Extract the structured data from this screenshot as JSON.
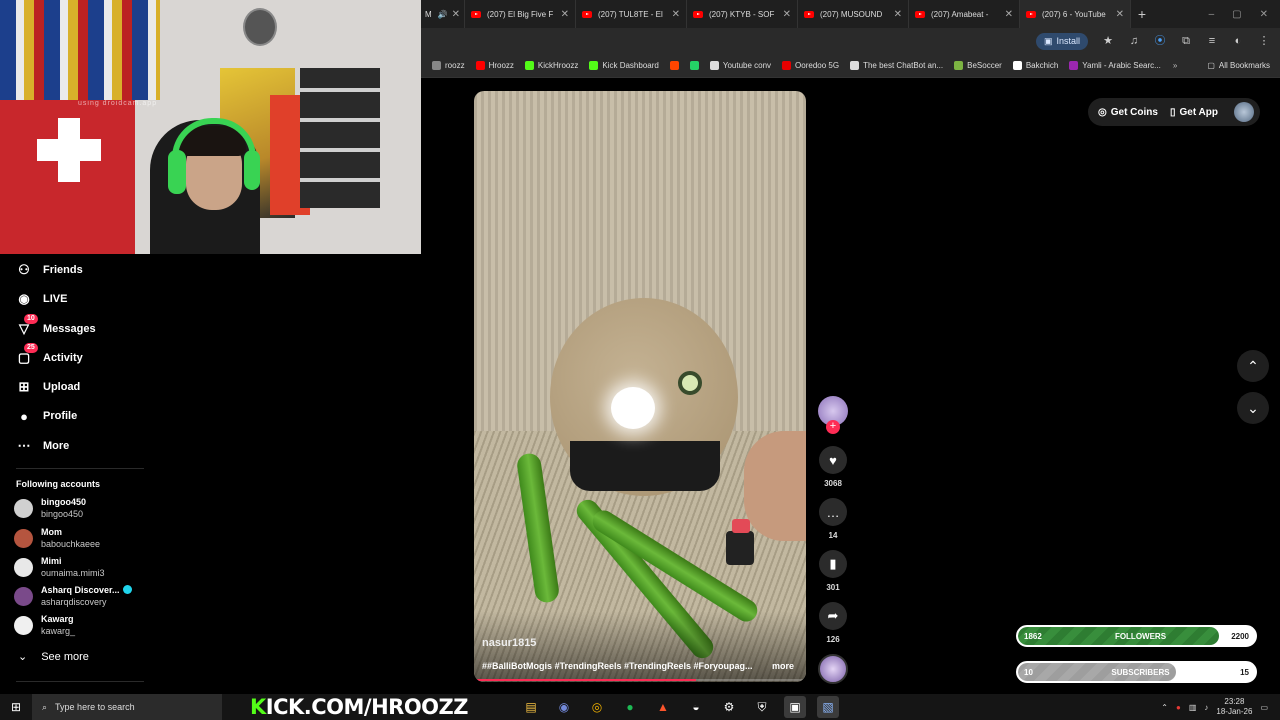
{
  "browser": {
    "tabs": [
      {
        "label": "M"
      },
      {
        "label": "(207) El Big Five F"
      },
      {
        "label": "(207) TUL8TE - El"
      },
      {
        "label": "(207) KTYB - SOF"
      },
      {
        "label": "(207) MUSOUND"
      },
      {
        "label": "(207) Amabeat -"
      },
      {
        "label": "(207) 6 - YouTube"
      }
    ],
    "install_label": "Install",
    "bookmarks": [
      {
        "label": "roozz",
        "color": "#888888"
      },
      {
        "label": "Hroozz",
        "color": "#ff0000"
      },
      {
        "label": "KickHroozz",
        "color": "#53fc18"
      },
      {
        "label": "Kick Dashboard",
        "color": "#53fc18"
      },
      {
        "label": "",
        "color": "#ff4500"
      },
      {
        "label": "",
        "color": "#25d366"
      },
      {
        "label": "Youtube conv",
        "color": "#dddddd"
      },
      {
        "label": "Ooredoo 5G",
        "color": "#e60000"
      },
      {
        "label": "The best ChatBot an...",
        "color": "#dddddd"
      },
      {
        "label": "BeSoccer",
        "color": "#7cb342"
      },
      {
        "label": "Bakchich",
        "color": "#ffffff"
      },
      {
        "label": "Yamli - Arabic Searc...",
        "color": "#9c27b0"
      }
    ],
    "all_bookmarks": "All Bookmarks"
  },
  "webcam": {
    "watermark": "using droidcam.app"
  },
  "sidebar": {
    "items": [
      {
        "label": "Friends",
        "icon": "friends-icon",
        "glyph": "⚇"
      },
      {
        "label": "LIVE",
        "icon": "live-icon",
        "glyph": "◉"
      },
      {
        "label": "Messages",
        "icon": "messages-icon",
        "glyph": "▽",
        "badge": "10"
      },
      {
        "label": "Activity",
        "icon": "activity-icon",
        "glyph": "▢",
        "badge": "25"
      },
      {
        "label": "Upload",
        "icon": "upload-icon",
        "glyph": "⊞"
      },
      {
        "label": "Profile",
        "icon": "profile-icon",
        "glyph": "●"
      },
      {
        "label": "More",
        "icon": "more-icon",
        "glyph": "⋯"
      }
    ],
    "following_title": "Following accounts",
    "accounts": [
      {
        "name": "bingoo450",
        "handle": "bingoo450",
        "color": "#d0d0d0",
        "verified": false
      },
      {
        "name": "Mom",
        "handle": "babouchkaeee",
        "color": "#b5553f",
        "verified": false
      },
      {
        "name": "Mimi",
        "handle": "oumaima.mimi3",
        "color": "#e8e8e8",
        "verified": false
      },
      {
        "name": "Asharq Discover...",
        "handle": "asharqdiscovery",
        "color": "#7a4a8a",
        "verified": true
      },
      {
        "name": "Kawarg",
        "handle": "kawarg_",
        "color": "#f0f0f0",
        "verified": false
      }
    ],
    "see_more": "See more"
  },
  "video": {
    "author": "nasur1815",
    "caption": "##BalliBotMogis #TrendingReels #TrendingReels #Foryoupag...",
    "more": "more",
    "progress": 0.67
  },
  "actions": {
    "likes": "3068",
    "comments": "14",
    "saves": "301",
    "shares": "126"
  },
  "topright": {
    "get_coins": "Get Coins",
    "get_app": "Get App"
  },
  "goals": [
    {
      "current": "1862",
      "label": "FOLLOWERS",
      "target": "2200",
      "progress": 0.846,
      "color": "#2e7d32"
    },
    {
      "current": "10",
      "label": "SUBSCRIBERS",
      "target": "15",
      "progress": 0.667,
      "color": "#9e9e9e"
    }
  ],
  "taskbar": {
    "search_placeholder": "Type here to search",
    "kick_prefix": "K",
    "kick_url": "ICK.COM/HROOZZ",
    "time": "23:28",
    "date": "18-Jan-26"
  }
}
